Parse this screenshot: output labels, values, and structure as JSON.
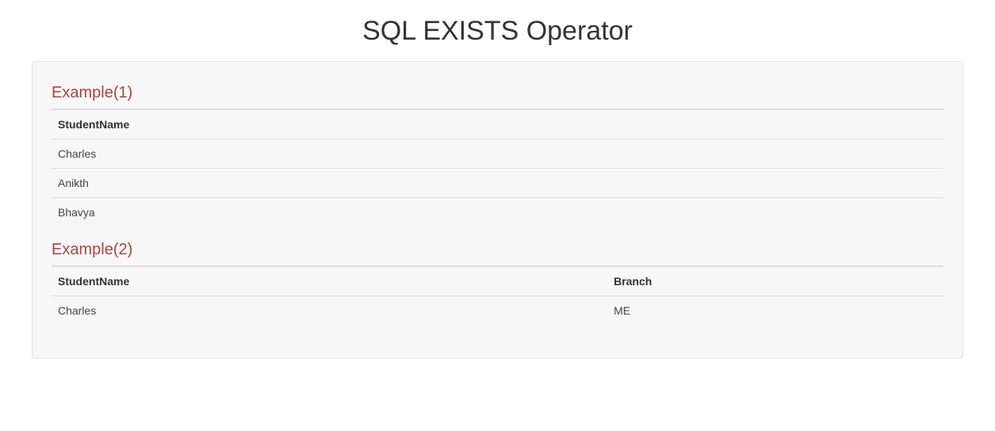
{
  "title": "SQL EXISTS Operator",
  "example1": {
    "heading": "Example(1)",
    "columns": [
      "StudentName"
    ],
    "rows": [
      {
        "StudentName": "Charles"
      },
      {
        "StudentName": "Anikth"
      },
      {
        "StudentName": "Bhavya"
      }
    ]
  },
  "example2": {
    "heading": "Example(2)",
    "columns": [
      "StudentName",
      "Branch"
    ],
    "rows": [
      {
        "StudentName": "Charles",
        "Branch": "ME"
      }
    ]
  }
}
